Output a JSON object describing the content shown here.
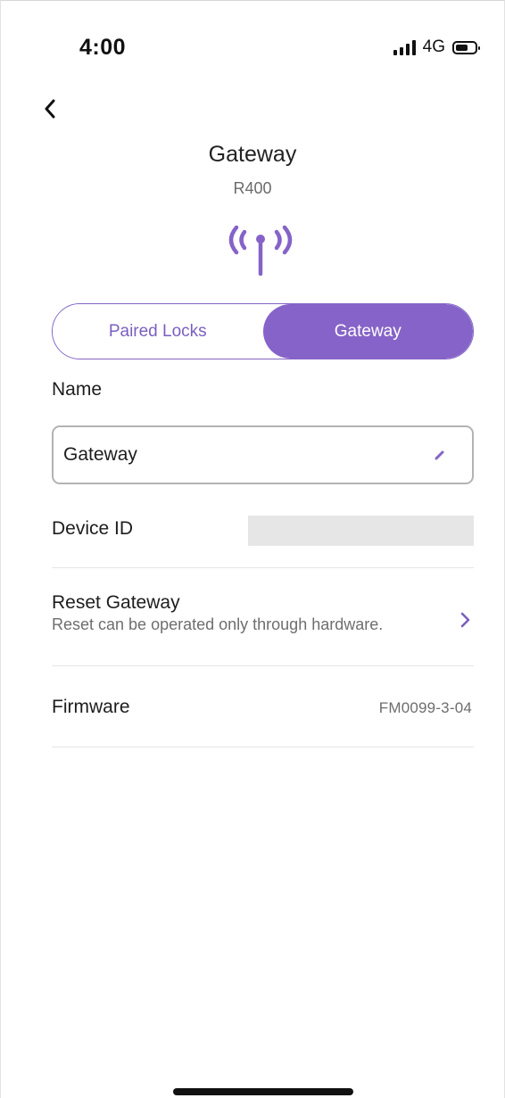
{
  "status_bar": {
    "time": "4:00",
    "network": "4G",
    "signal_icon": "signal-bars-icon",
    "battery_icon": "battery-icon"
  },
  "nav": {
    "back_icon": "chevron-left-icon"
  },
  "header": {
    "title": "Gateway",
    "model": "R400",
    "device_icon": "broadcast-antenna-icon"
  },
  "tabs": [
    {
      "label": "Paired Locks",
      "active": false
    },
    {
      "label": "Gateway",
      "active": true
    }
  ],
  "name_section": {
    "label": "Name",
    "value": "Gateway",
    "edit_icon": "pencil-icon"
  },
  "device_id": {
    "label": "Device ID",
    "value": ""
  },
  "reset": {
    "title": "Reset Gateway",
    "subtitle": "Reset can be operated only through hardware.",
    "chevron_icon": "chevron-right-icon"
  },
  "firmware": {
    "label": "Firmware",
    "value": "FM0099-3-04"
  },
  "colors": {
    "accent": "#8663c8",
    "divider": "#e6e6e6",
    "masked": "#e6e6e6"
  }
}
